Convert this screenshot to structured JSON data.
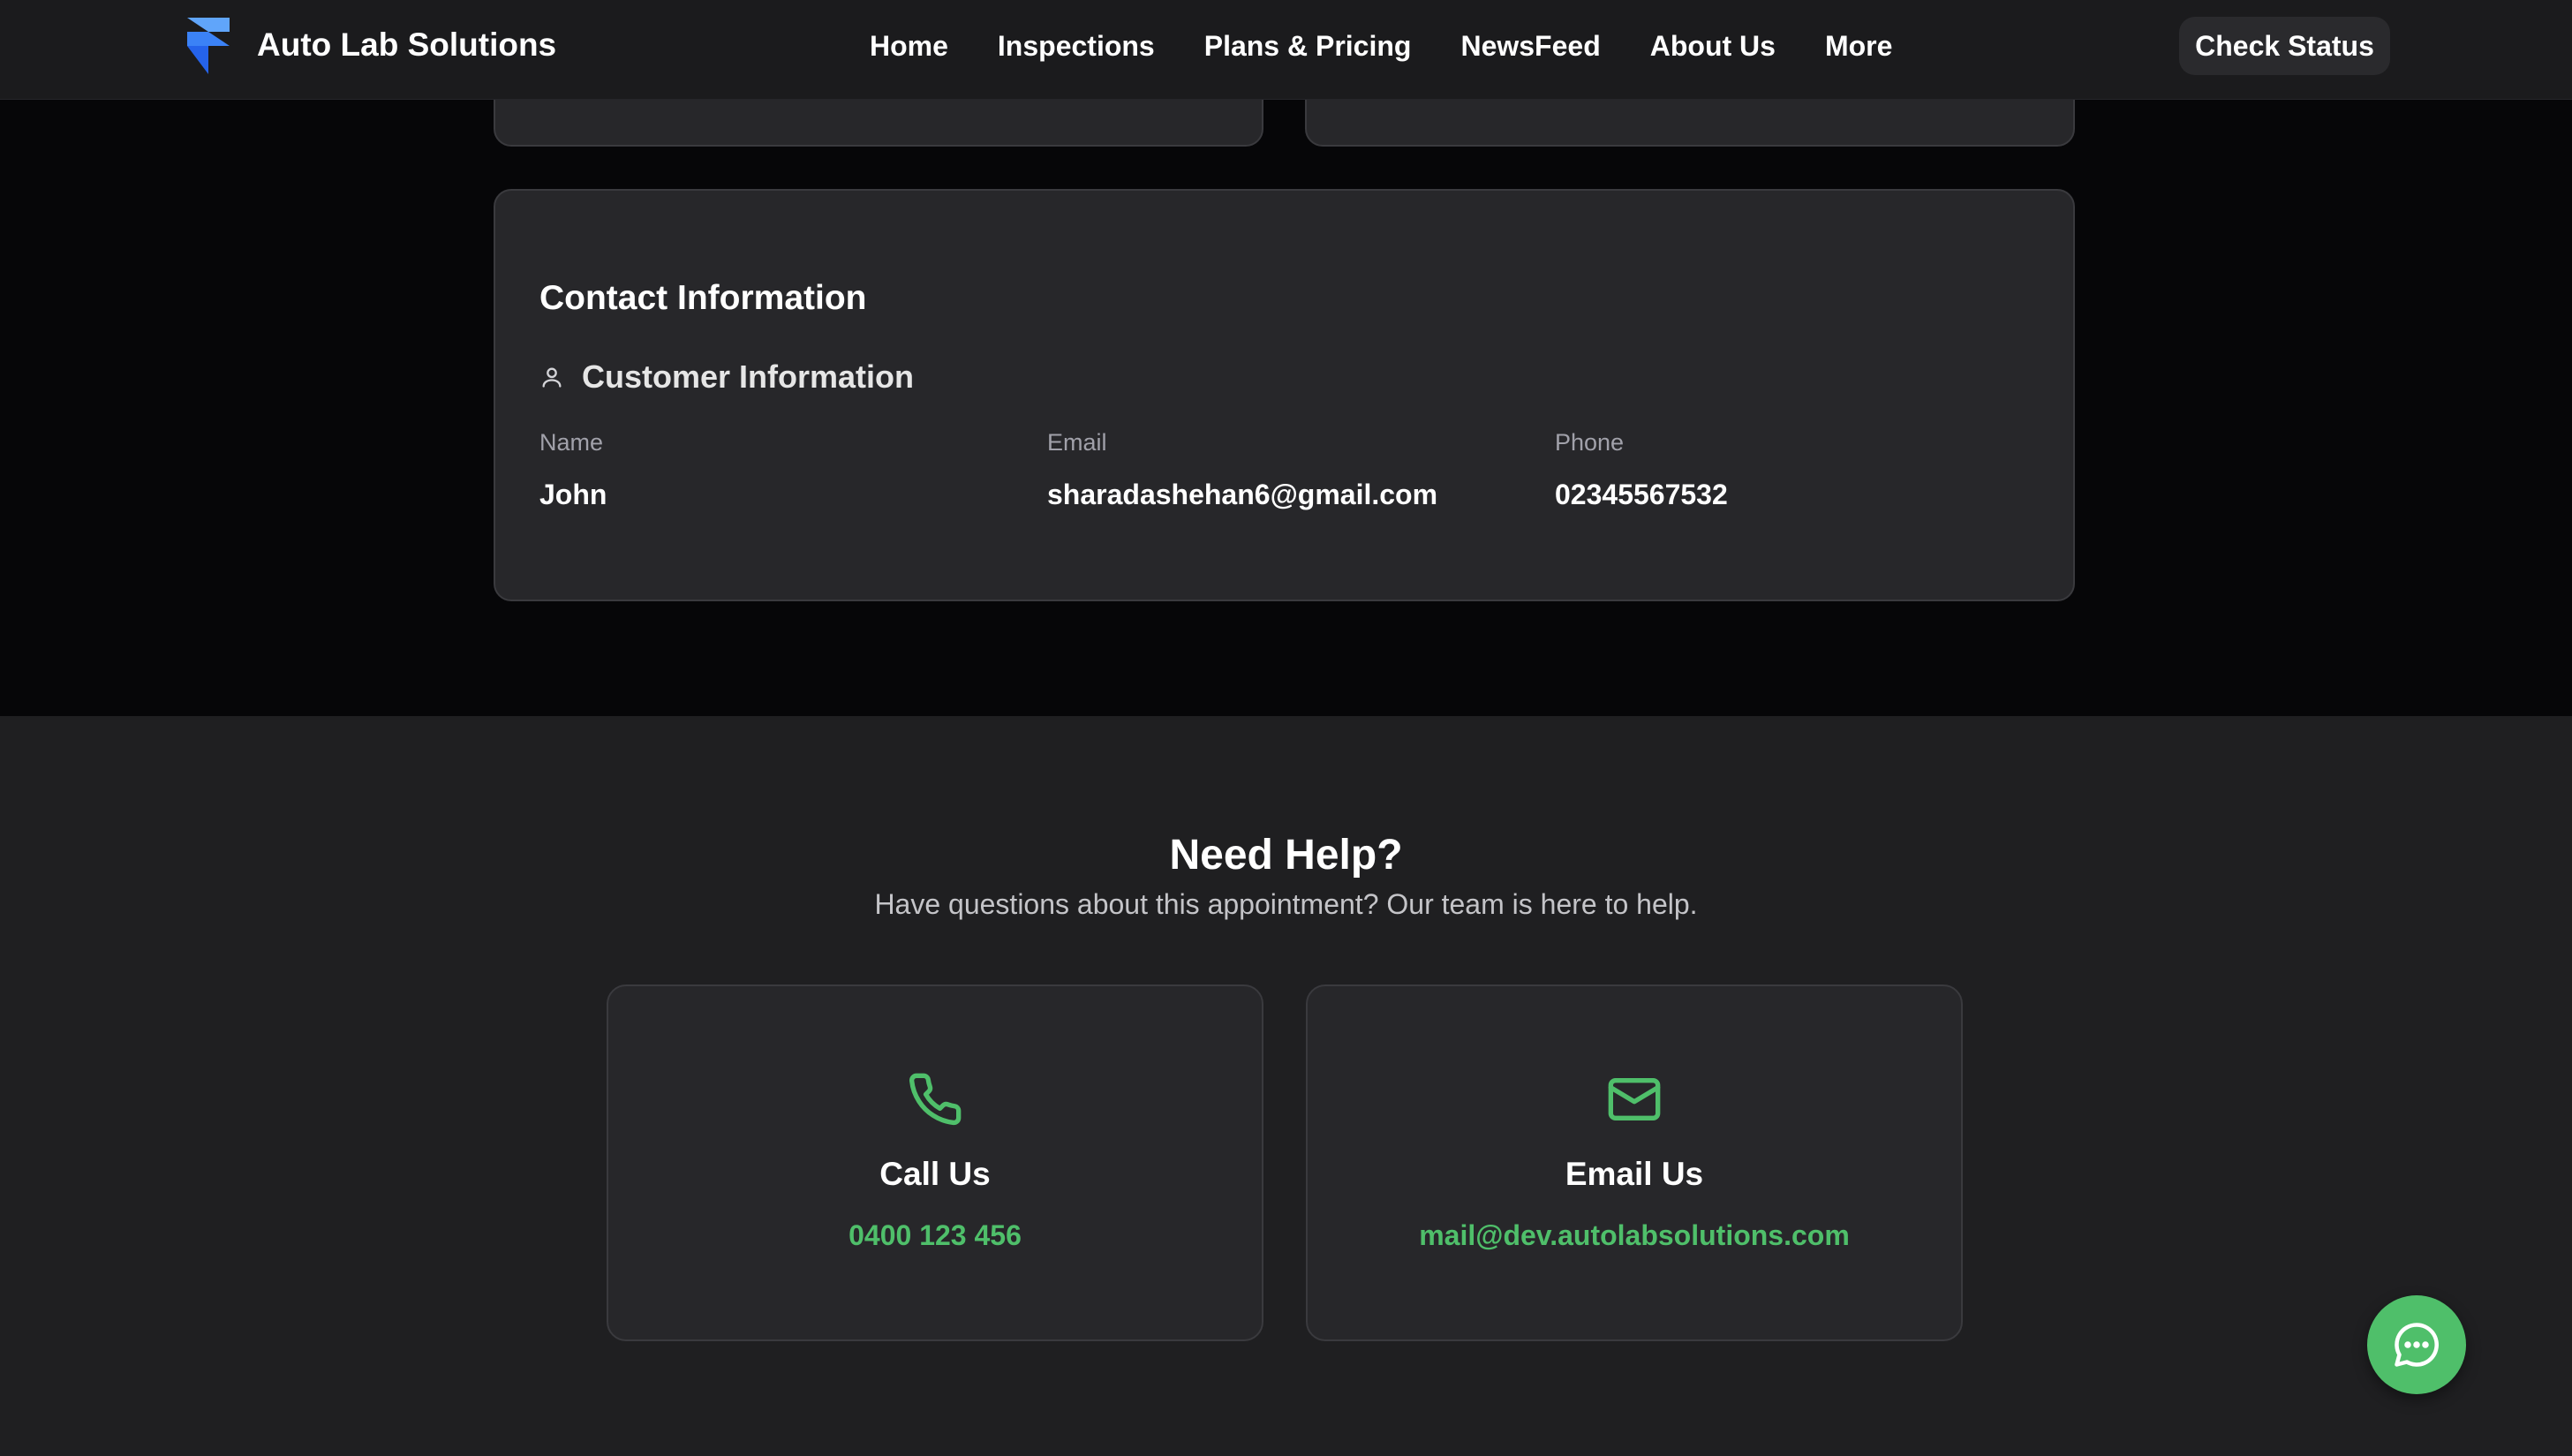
{
  "brand": {
    "name": "Auto Lab Solutions"
  },
  "nav": {
    "items": [
      "Home",
      "Inspections",
      "Plans & Pricing",
      "NewsFeed",
      "About Us",
      "More"
    ],
    "check_status": "Check Status"
  },
  "contact": {
    "title": "Contact Information",
    "customer_title": "Customer Information",
    "name_label": "Name",
    "name_value": "John",
    "email_label": "Email",
    "email_value": "sharadashehan6@gmail.com",
    "phone_label": "Phone",
    "phone_value": "02345567532"
  },
  "help": {
    "title": "Need Help?",
    "subtitle": "Have questions about this appointment? Our team is here to help.",
    "call": {
      "label": "Call Us",
      "value": "0400 123 456"
    },
    "email": {
      "label": "Email Us",
      "value": "mail@dev.autolabsolutions.com"
    }
  },
  "colors": {
    "accent": "#4fbf6a",
    "card_bg": "#27272a",
    "page_bg": "#060608",
    "help_bg": "#1f1f21"
  },
  "icons": {
    "logo": "framer-logo-icon",
    "customer": "user-icon",
    "call": "phone-icon",
    "email": "mail-icon",
    "chat": "chat-bubble-icon"
  }
}
